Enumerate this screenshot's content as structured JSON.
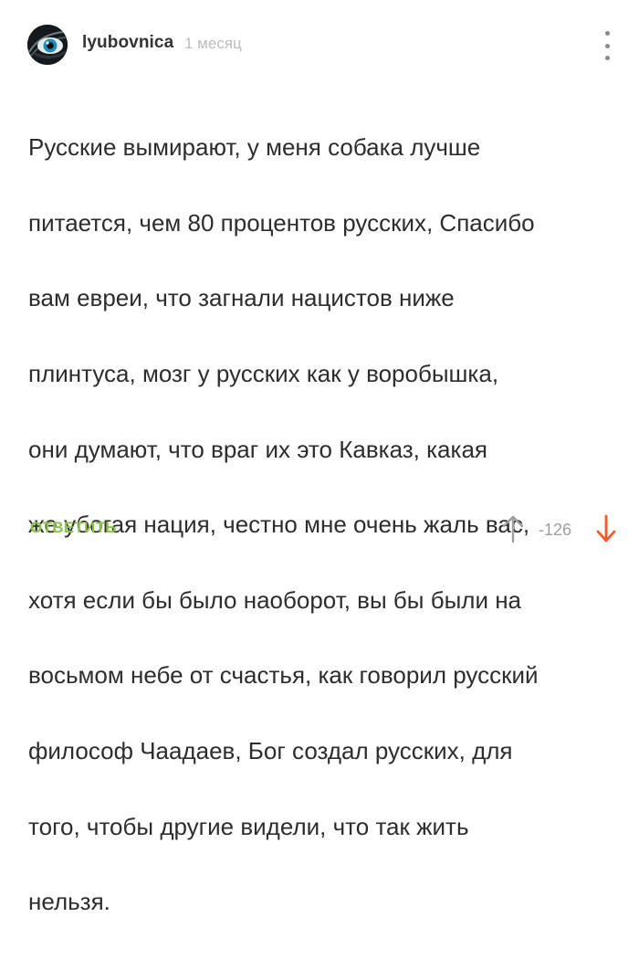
{
  "comment": {
    "author": "lyubovnica",
    "time": "1 месяц",
    "lines": [
      "Русские вымирают, у меня собака лучше",
      "питается, чем 80 процентов русских, Спасибо",
      "вам евреи, что загнали нацистов ниже",
      "плинтуса, мозг у русских как у воробышка,",
      "они думают, что враг их это Кавказ, какая",
      "же убогая нация, честно мне очень жаль вас,",
      "хотя если бы было наоборот, вы бы были на",
      "восьмом небе от счастья, как говорил русский",
      "философ Чаадаев, Бог создал русских, для",
      "того, чтобы другие видели, что так жить",
      "нельзя."
    ],
    "reply_label": "ОТВЕТИТЬ",
    "rating": "-126"
  },
  "icons": {
    "more": "vertical-dots-icon",
    "upvote": "arrow-up-icon",
    "downvote": "arrow-down-icon"
  },
  "colors": {
    "reply": "#8bc34a",
    "downvote": "#ff5722",
    "upvote": "#9e9e9e",
    "rating": "#9e9e9e",
    "time": "#bdbdbd"
  }
}
